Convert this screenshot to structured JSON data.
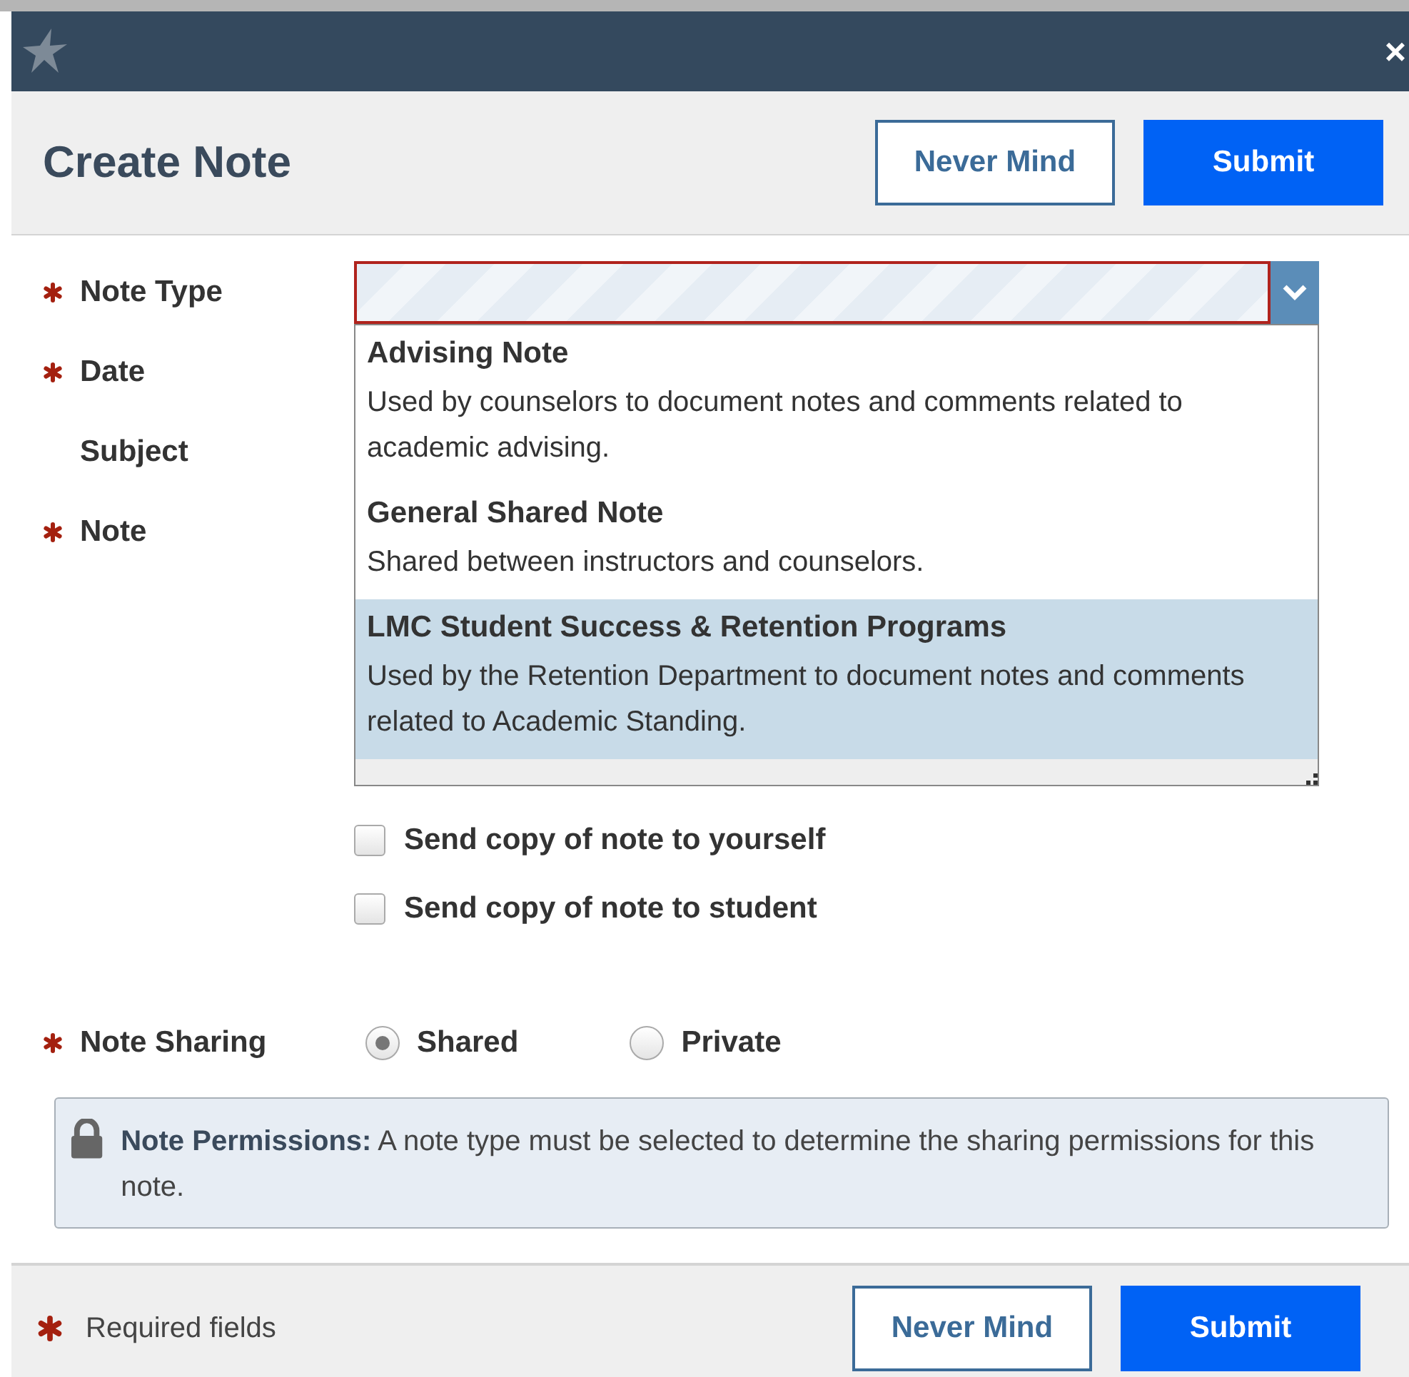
{
  "window": {
    "close": "×"
  },
  "header": {
    "title": "Create Note",
    "buttons": [
      {
        "label": "Never Mind",
        "kind": "secondary"
      },
      {
        "label": "Submit",
        "kind": "primary"
      }
    ]
  },
  "fields": [
    {
      "label": "Note Type",
      "required": true
    },
    {
      "label": "Date",
      "required": true
    },
    {
      "label": "Subject",
      "required": false
    },
    {
      "label": "Note",
      "required": true
    }
  ],
  "note_type_select": {
    "expanded": true,
    "invalid": true,
    "options": [
      {
        "title": "Advising Note",
        "description": "Used by counselors to document notes and comments related to academic advising.",
        "selected": false
      },
      {
        "title": "General Shared Note",
        "description": "Shared between instructors and counselors.",
        "selected": false
      },
      {
        "title": "LMC Student Success & Retention Programs",
        "description": "Used by the Retention Department to document notes and comments related to Academic Standing.",
        "selected": true
      }
    ]
  },
  "copy_options": [
    {
      "label": "Send copy of note to yourself",
      "checked": false
    },
    {
      "label": "Send copy of note to student",
      "checked": false
    }
  ],
  "note_sharing": {
    "label": "Note Sharing",
    "required": true,
    "options": [
      {
        "label": "Shared",
        "selected": true
      },
      {
        "label": "Private",
        "selected": false
      }
    ]
  },
  "permissions": {
    "text": "**Note Permissions:** A note type must be selected to determine the sharing permissions for this note."
  },
  "footer": {
    "legend": "Required fields",
    "buttons": [
      {
        "label": "Never Mind",
        "kind": "secondary"
      },
      {
        "label": "Submit",
        "kind": "primary"
      }
    ]
  }
}
